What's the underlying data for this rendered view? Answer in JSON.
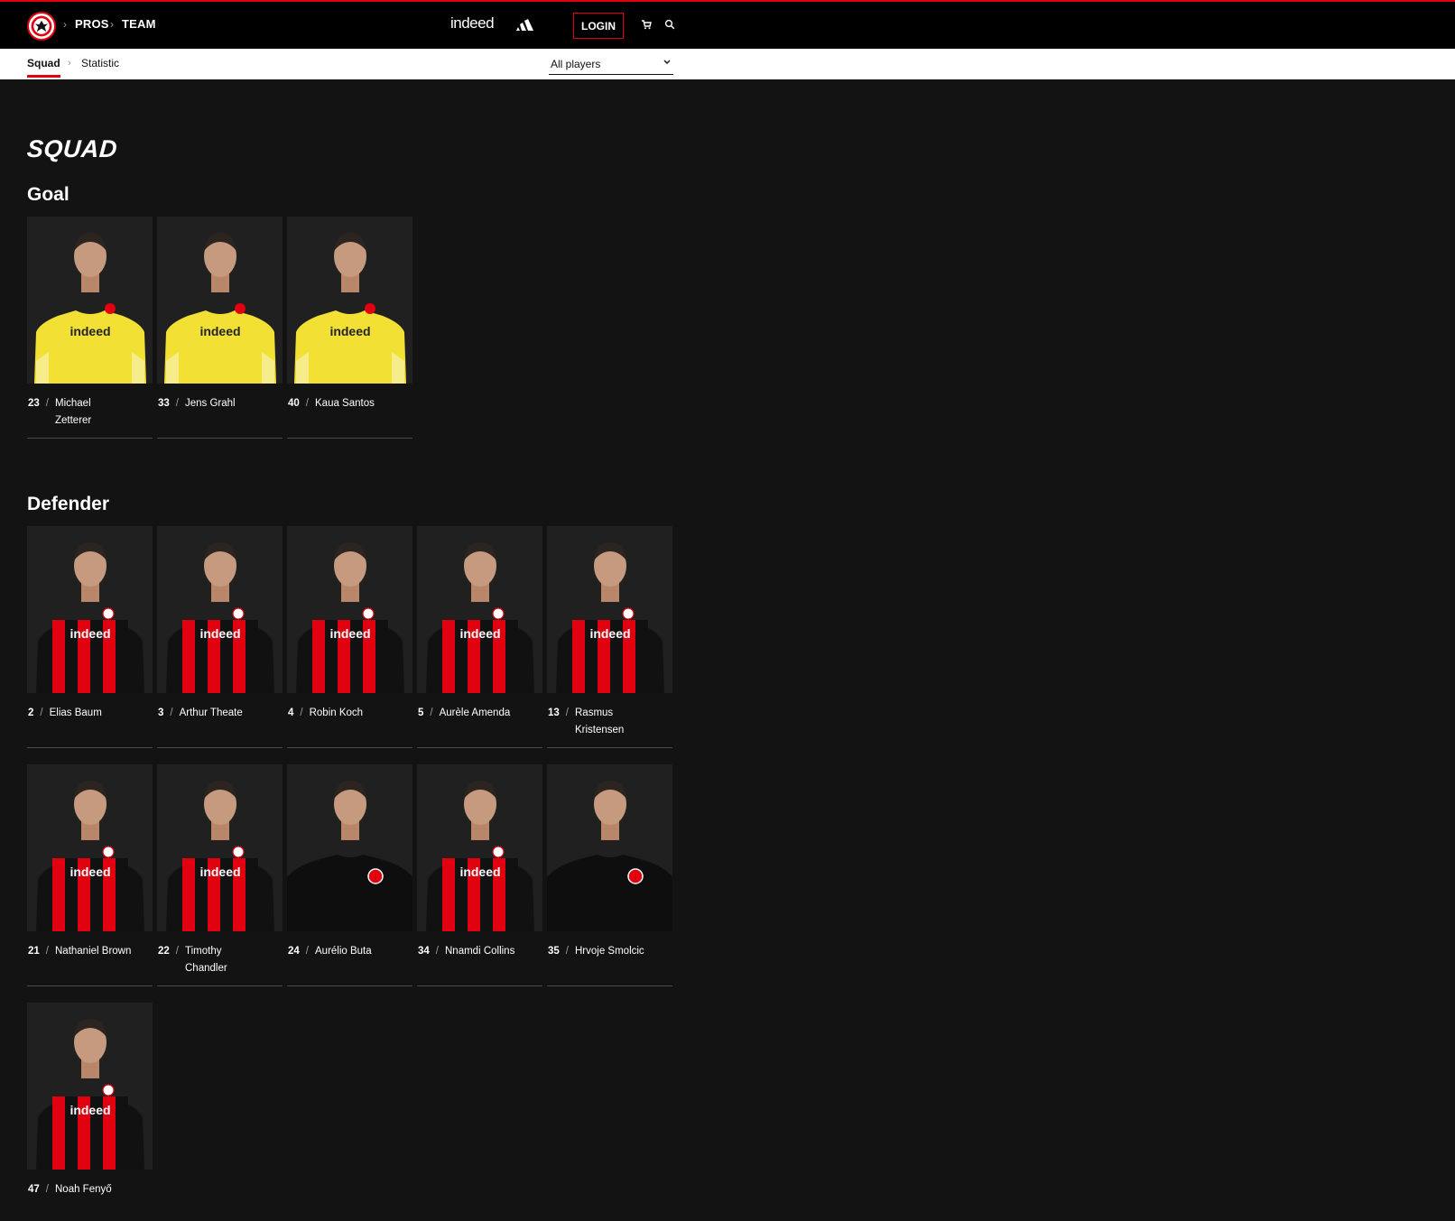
{
  "nav": {
    "breadcrumb": [
      "PROS",
      "TEAM"
    ],
    "sponsor": "indeed",
    "login_label": "LOGIN"
  },
  "subnav": {
    "tabs": [
      "Squad",
      "Statistic"
    ],
    "filter_value": "All players"
  },
  "page_title": "SQUAD",
  "groups": [
    {
      "title": "Goal",
      "players": [
        {
          "number": "23",
          "first": "Michael",
          "last": "Zetterer",
          "kit": "gk"
        },
        {
          "number": "33",
          "first": "Jens Grahl",
          "last": "",
          "kit": "gk"
        },
        {
          "number": "40",
          "first": "Kaua Santos",
          "last": "",
          "kit": "gk"
        }
      ]
    },
    {
      "title": "Defender",
      "players": [
        {
          "number": "2",
          "first": "Elias Baum",
          "last": "",
          "kit": "home"
        },
        {
          "number": "3",
          "first": "Arthur Theate",
          "last": "",
          "kit": "home"
        },
        {
          "number": "4",
          "first": "Robin Koch",
          "last": "",
          "kit": "home"
        },
        {
          "number": "5",
          "first": "Aurèle Amenda",
          "last": "",
          "kit": "home"
        },
        {
          "number": "13",
          "first": "Rasmus",
          "last": "Kristensen",
          "kit": "home"
        },
        {
          "number": "21",
          "first": "Nathaniel Brown",
          "last": "",
          "kit": "home"
        },
        {
          "number": "22",
          "first": "Timothy",
          "last": "Chandler",
          "kit": "home"
        },
        {
          "number": "24",
          "first": "Aurélio Buta",
          "last": "",
          "kit": "black"
        },
        {
          "number": "34",
          "first": "Nnamdi Collins",
          "last": "",
          "kit": "home"
        },
        {
          "number": "35",
          "first": "Hrvoje Smolcic",
          "last": "",
          "kit": "black"
        },
        {
          "number": "47",
          "first": "Noah Fenyő",
          "last": "",
          "kit": "home"
        }
      ]
    }
  ],
  "colors": {
    "accent": "#e1000f",
    "background": "#131313",
    "gk_kit": "#f3e034"
  }
}
